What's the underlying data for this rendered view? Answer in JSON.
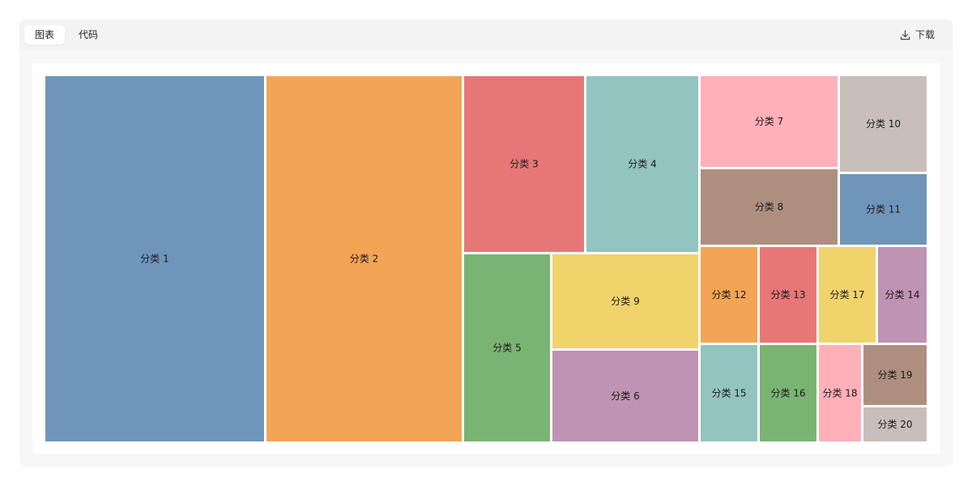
{
  "toolbar": {
    "tabs": [
      {
        "label": "图表",
        "active": true
      },
      {
        "label": "代码",
        "active": false
      }
    ],
    "download_label": "下载"
  },
  "chart_data": {
    "type": "treemap",
    "items": [
      {
        "name": "分类 1",
        "value": 1000,
        "color": "#6f95ba"
      },
      {
        "name": "分类 2",
        "value": 900,
        "color": "#f3a455"
      },
      {
        "name": "分类 3",
        "value": 550,
        "color": "#e77777"
      },
      {
        "name": "分类 4",
        "value": 500,
        "color": "#93c4bf"
      },
      {
        "name": "分类 5",
        "value": 400,
        "color": "#7ab472"
      },
      {
        "name": "分类 9",
        "value": 350,
        "color": "#f1d36c"
      },
      {
        "name": "分类 6",
        "value": 280,
        "color": "#be93b3"
      },
      {
        "name": "分类 7",
        "value": 300,
        "color": "#ffb0b8"
      },
      {
        "name": "分类 10",
        "value": 200,
        "color": "#c8bfbb"
      },
      {
        "name": "分类 8",
        "value": 250,
        "color": "#ae8f7f"
      },
      {
        "name": "分类 11",
        "value": 150,
        "color": "#6f95ba"
      },
      {
        "name": "分类 12",
        "value": 150,
        "color": "#f3a455"
      },
      {
        "name": "分类 13",
        "value": 150,
        "color": "#e77777"
      },
      {
        "name": "分类 17",
        "value": 150,
        "color": "#f1d36c"
      },
      {
        "name": "分类 14",
        "value": 150,
        "color": "#be93b3"
      },
      {
        "name": "分类 15",
        "value": 150,
        "color": "#93c4bf"
      },
      {
        "name": "分类 16",
        "value": 150,
        "color": "#7ab472"
      },
      {
        "name": "分类 18",
        "value": 100,
        "color": "#ffb0b8"
      },
      {
        "name": "分类 19",
        "value": 100,
        "color": "#ae8f7f"
      },
      {
        "name": "分类 20",
        "value": 50,
        "color": "#c8bfbb"
      }
    ]
  }
}
